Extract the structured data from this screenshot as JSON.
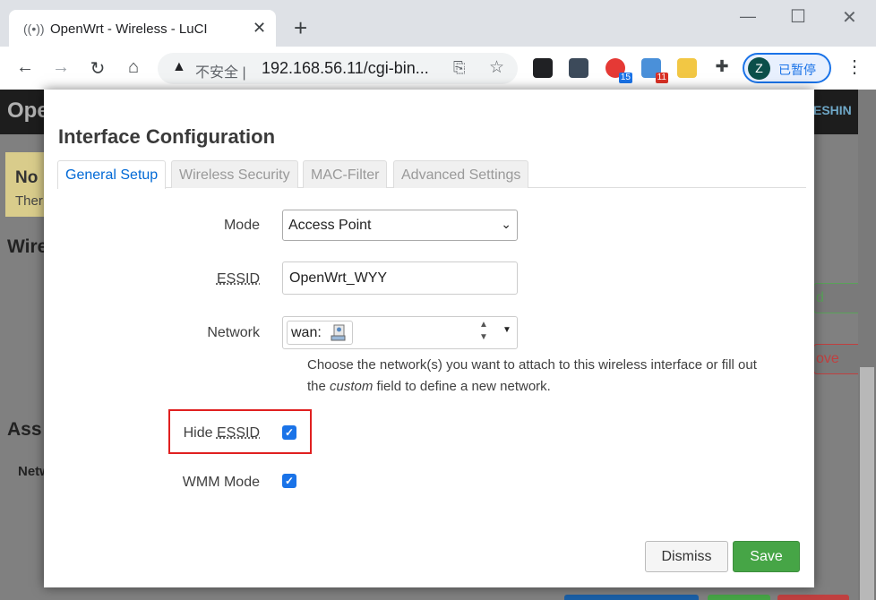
{
  "browser": {
    "tab_title": "OpenWrt - Wireless - LuCI",
    "insecure_label": "不安全",
    "url": "192.168.56.11/cgi-bin...",
    "profile_initial": "Z",
    "profile_status": "已暂停",
    "ext_badges": [
      "15",
      "11"
    ]
  },
  "page": {
    "brand": "Ope",
    "header_right": "ESHIN",
    "alert_title": "No",
    "alert_text": "Ther",
    "heading_wireless": "Wire",
    "heading_associated": "Ass",
    "col_network": "Netw",
    "btn_add_fragment": "d",
    "btn_remove_fragment": "ove"
  },
  "modal": {
    "title": "Interface Configuration",
    "tabs": [
      "General Setup",
      "Wireless Security",
      "MAC-Filter",
      "Advanced Settings"
    ],
    "active_tab": 0,
    "fields": {
      "mode_label": "Mode",
      "mode_value": "Access Point",
      "essid_label": "ESSID",
      "essid_value": "OpenWrt_WYY",
      "network_label": "Network",
      "network_value": "wan:",
      "network_help_1": "Choose the network(s) you want to attach to this wireless interface or fill out",
      "network_help_2a": "the ",
      "network_help_custom": "custom",
      "network_help_2b": " field to define a new network.",
      "hide_label_prefix": "Hide ",
      "hide_label_abbr": "ESSID",
      "hide_checked": true,
      "wmm_label": "WMM Mode",
      "wmm_checked": true
    },
    "dismiss_label": "Dismiss",
    "save_label": "Save"
  },
  "colors": {
    "accent": "#0069d6",
    "save": "#46a546",
    "highlight": "#e02020",
    "checkbox": "#1a73e8"
  }
}
